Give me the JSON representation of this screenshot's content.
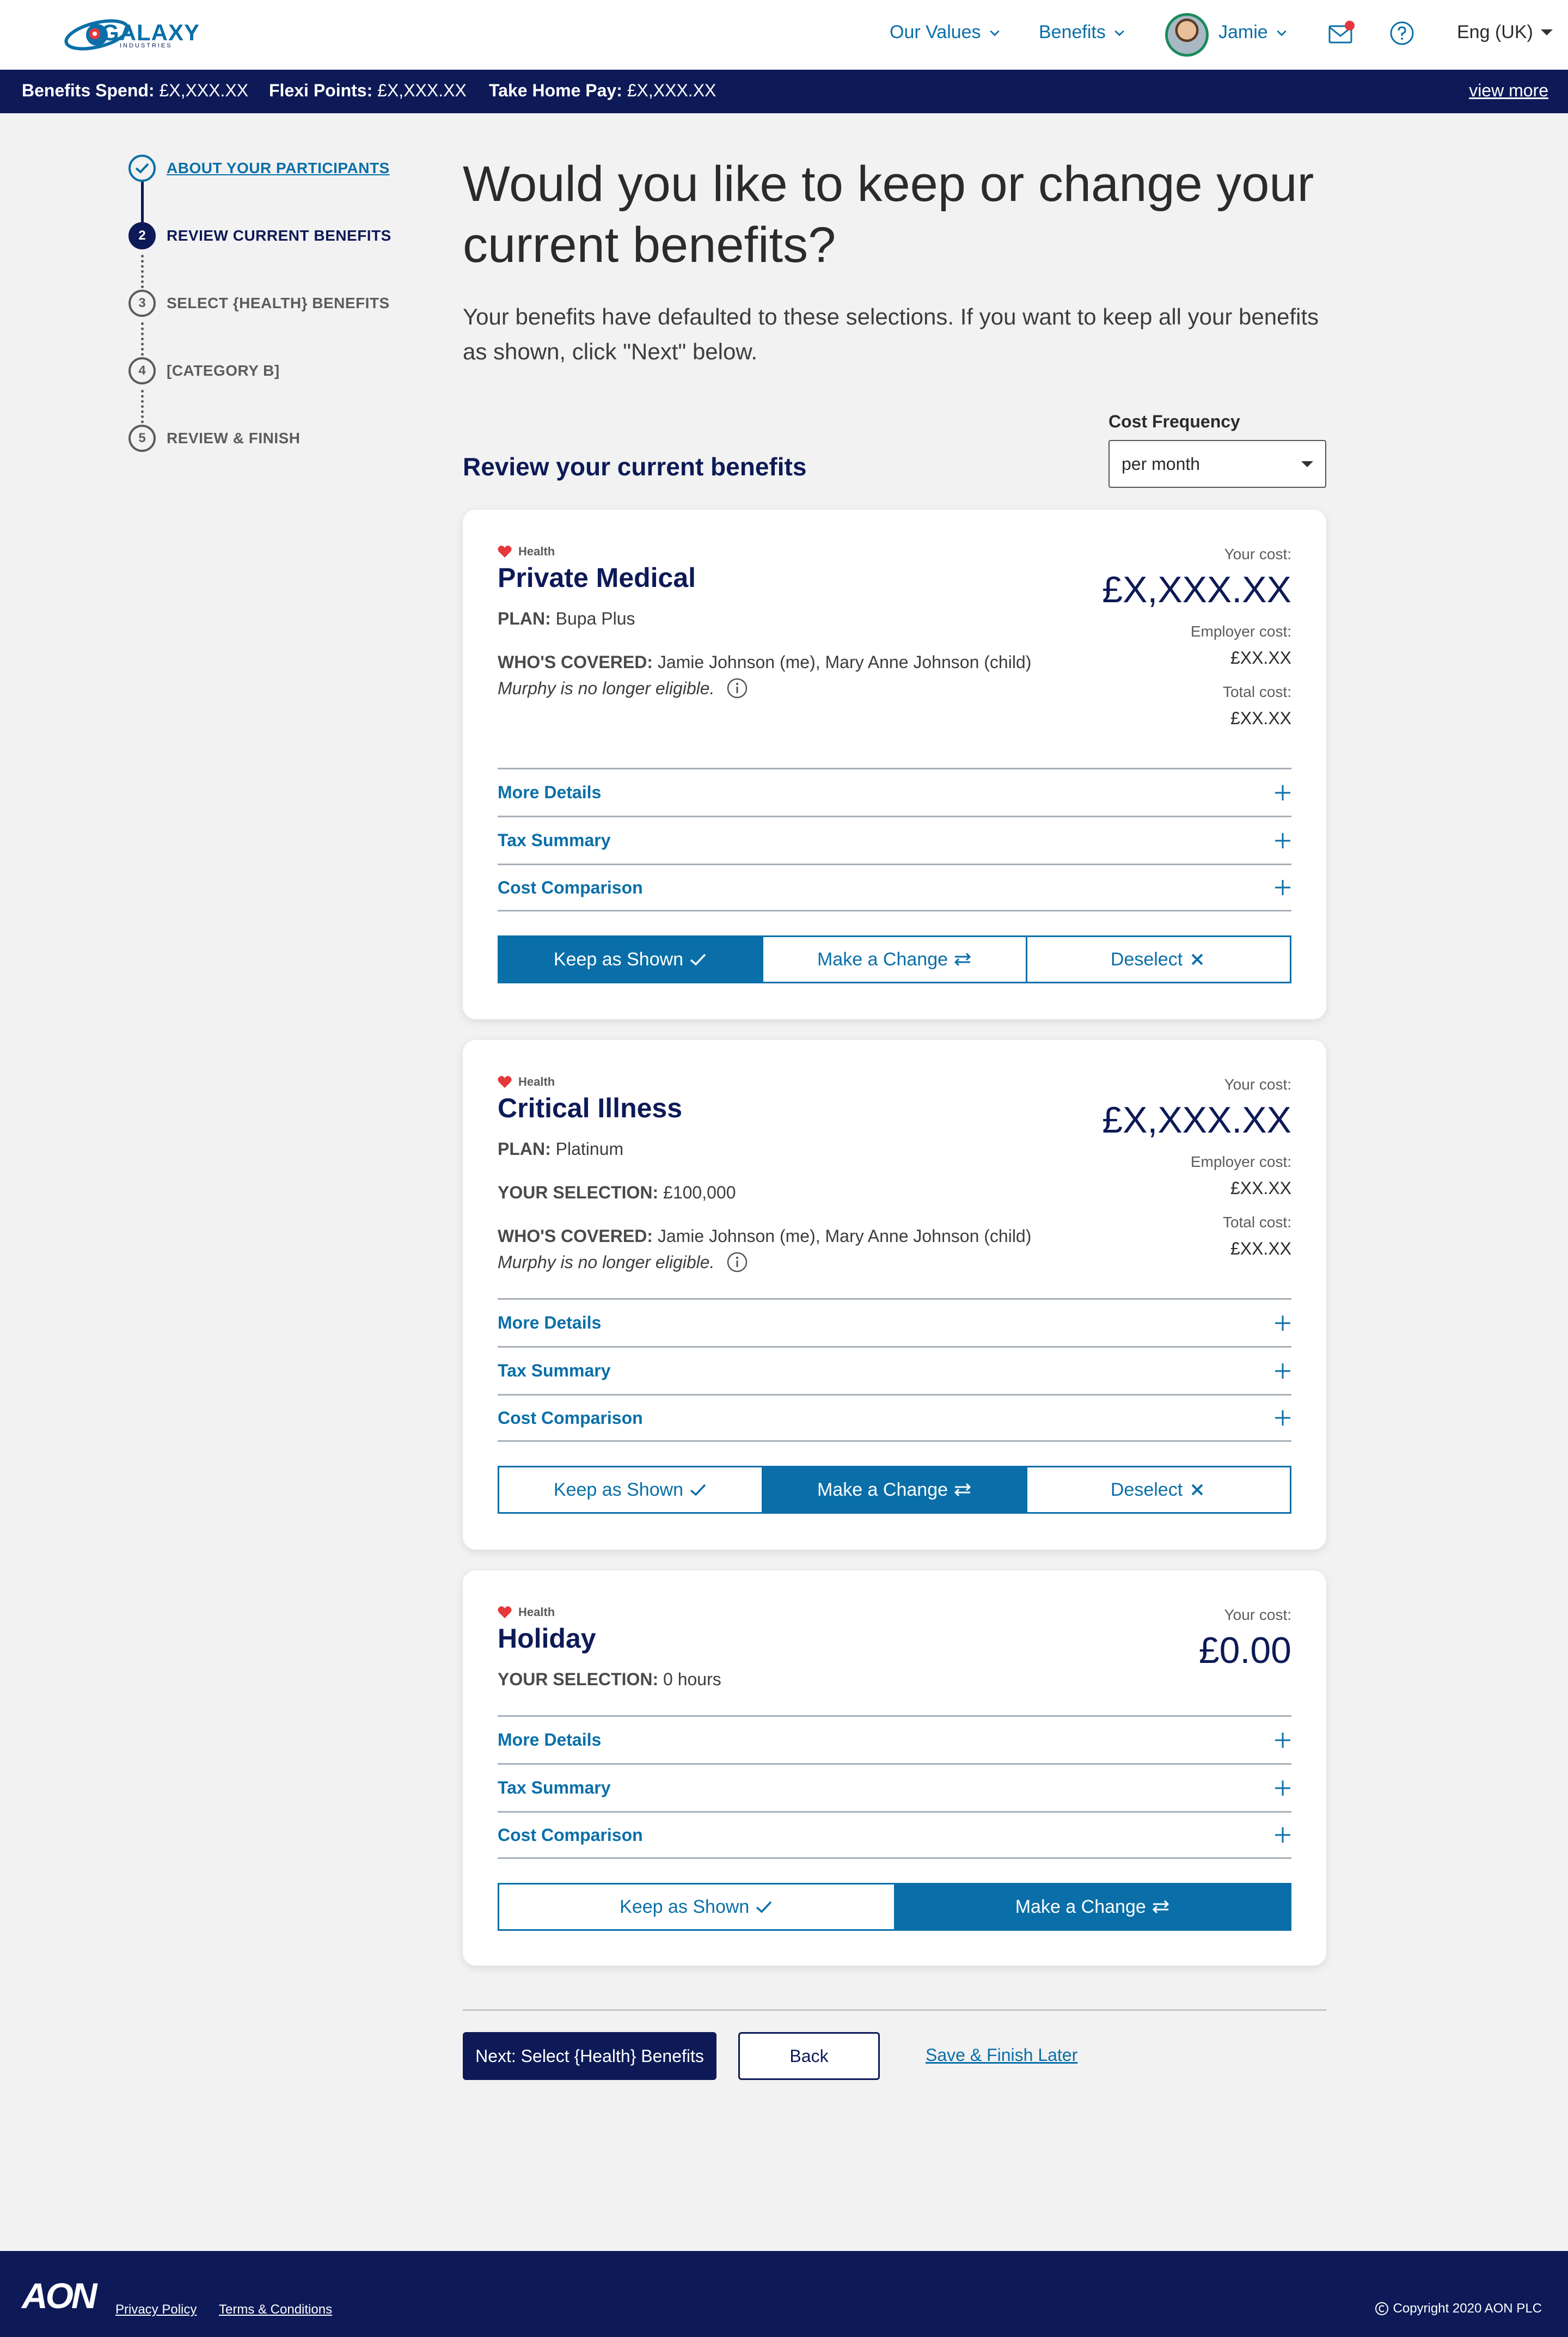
{
  "header": {
    "logo": {
      "name": "GALAXY",
      "sub": "INDUSTRIES"
    },
    "nav": [
      {
        "label": "Our Values"
      },
      {
        "label": "Benefits"
      }
    ],
    "user": {
      "name": "Jamie"
    },
    "language": "Eng (UK)"
  },
  "summary_bar": {
    "benefits_spend": {
      "label": "Benefits Spend:",
      "value": "£X,XXX.XX"
    },
    "flexi_points": {
      "label": "Flexi Points:",
      "value": "£X,XXX.XX"
    },
    "take_home": {
      "label": "Take Home Pay:",
      "value": "£X,XXX.XX"
    },
    "view_more": "view more"
  },
  "stepper": {
    "steps": [
      {
        "num": "1",
        "label": "ABOUT YOUR PARTICIPANTS",
        "state": "done"
      },
      {
        "num": "2",
        "label": "REVIEW CURRENT BENEFITS",
        "state": "current"
      },
      {
        "num": "3",
        "label": "SELECT {HEALTH} BENEFITS",
        "state": "todo"
      },
      {
        "num": "4",
        "label": "[CATEGORY B]",
        "state": "todo"
      },
      {
        "num": "5",
        "label": "REVIEW & FINISH",
        "state": "todo"
      }
    ]
  },
  "main": {
    "title": "Would you like to keep or change your current benefits?",
    "intro": "Your benefits have defaulted to these selections. If you want to keep all your benefits as shown, click \"Next\" below.",
    "section_title": "Review your current benefits",
    "cost_frequency": {
      "label": "Cost Frequency",
      "value": "per month"
    }
  },
  "cards": [
    {
      "category": "Health",
      "title": "Private Medical",
      "plan_label": "PLAN:",
      "plan": "Bupa Plus",
      "covered_label": "WHO'S COVERED:",
      "covered": "Jamie Johnson (me), Mary Anne Johnson (child)",
      "note": "Murphy is no longer eligible.",
      "your_cost_label": "Your cost:",
      "your_cost": "£X,XXX.XX",
      "employer_cost_label": "Employer cost:",
      "employer_cost": "£XX.XX",
      "total_cost_label": "Total cost:",
      "total_cost": "£XX.XX",
      "accordion": [
        "More Details",
        "Tax Summary",
        "Cost Comparison"
      ],
      "actions": [
        "Keep as Shown",
        "Make a Change",
        "Deselect"
      ],
      "active_action": "Keep as Shown"
    },
    {
      "category": "Health",
      "title": "Critical Illness",
      "plan_label": "PLAN:",
      "plan": "Platinum",
      "selection_label": "YOUR SELECTION:",
      "selection": "£100,000",
      "covered_label": "WHO'S COVERED:",
      "covered": "Jamie Johnson (me), Mary Anne Johnson (child)",
      "note": "Murphy is no longer eligible.",
      "your_cost_label": "Your cost:",
      "your_cost": "£X,XXX.XX",
      "employer_cost_label": "Employer cost:",
      "employer_cost": "£XX.XX",
      "total_cost_label": "Total cost:",
      "total_cost": "£XX.XX",
      "accordion": [
        "More Details",
        "Tax Summary",
        "Cost Comparison"
      ],
      "actions": [
        "Keep as Shown",
        "Make a Change",
        "Deselect"
      ],
      "active_action": "Make a Change"
    },
    {
      "category": "Health",
      "title": "Holiday",
      "selection_label": "YOUR SELECTION:",
      "selection": "0 hours",
      "your_cost_label": "Your cost:",
      "your_cost": "£0.00",
      "accordion": [
        "More Details",
        "Tax Summary",
        "Cost Comparison"
      ],
      "actions": [
        "Keep as Shown",
        "Make a Change"
      ],
      "active_action": "Make a Change"
    }
  ],
  "footer_actions": {
    "next": "Next: Select {Health} Benefits",
    "back": "Back",
    "save": "Save & Finish Later"
  },
  "footer": {
    "logo": "AON",
    "privacy": "Privacy Policy",
    "terms": "Terms & Conditions",
    "copyright": "Copyright 2020 AON PLC"
  },
  "colors": {
    "navy": "#0d1a57",
    "blue": "#0a6fa8",
    "red": "#e5383b"
  }
}
